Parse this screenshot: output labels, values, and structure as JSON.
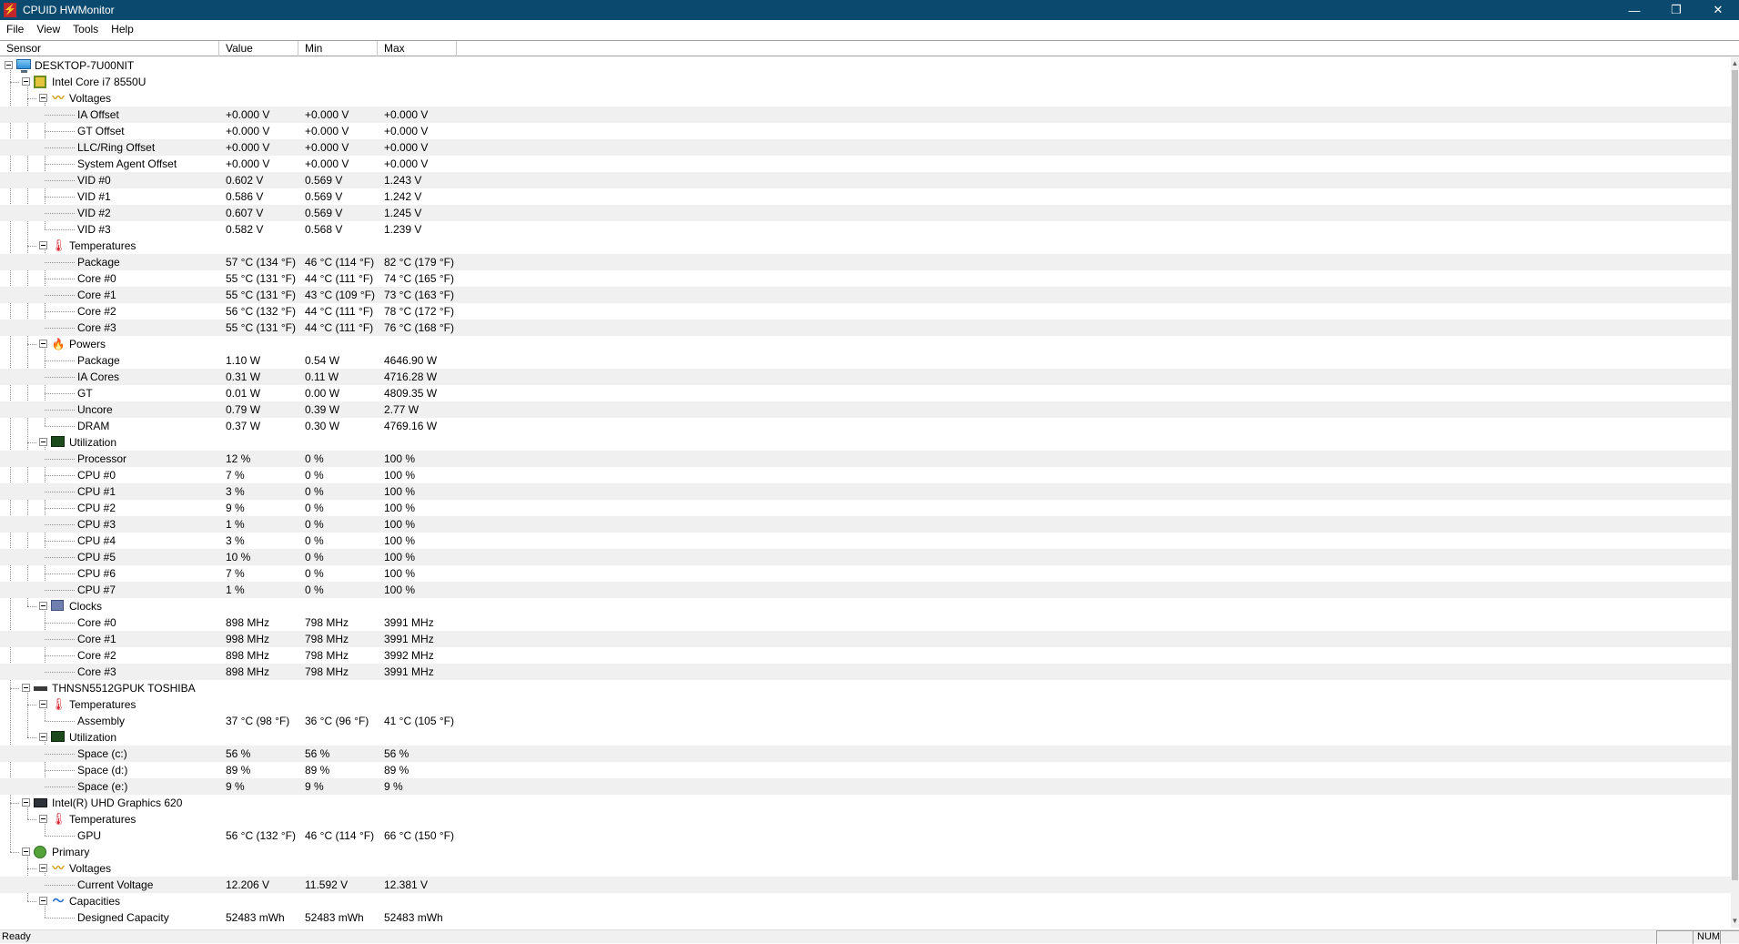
{
  "window": {
    "title": "CPUID HWMonitor",
    "icon": "hwmonitor-app-icon",
    "controls": {
      "minimize": "—",
      "restore": "❐",
      "close": "✕"
    }
  },
  "menu": [
    "File",
    "View",
    "Tools",
    "Help"
  ],
  "columns": {
    "sensor": "Sensor",
    "value": "Value",
    "min": "Min",
    "max": "Max"
  },
  "tree": [
    {
      "level": 0,
      "icon": "computer-icon",
      "label": "DESKTOP-7U00NIT"
    },
    {
      "level": 1,
      "icon": "cpu-icon",
      "label": "Intel Core i7 8550U"
    },
    {
      "level": 2,
      "icon": "voltage-icon",
      "label": "Voltages"
    },
    {
      "level": 3,
      "label": "IA Offset",
      "value": "+0.000 V",
      "min": "+0.000 V",
      "max": "+0.000 V"
    },
    {
      "level": 3,
      "label": "GT Offset",
      "value": "+0.000 V",
      "min": "+0.000 V",
      "max": "+0.000 V"
    },
    {
      "level": 3,
      "label": "LLC/Ring Offset",
      "value": "+0.000 V",
      "min": "+0.000 V",
      "max": "+0.000 V"
    },
    {
      "level": 3,
      "label": "System Agent Offset",
      "value": "+0.000 V",
      "min": "+0.000 V",
      "max": "+0.000 V"
    },
    {
      "level": 3,
      "label": "VID #0",
      "value": "0.602 V",
      "min": "0.569 V",
      "max": "1.243 V"
    },
    {
      "level": 3,
      "label": "VID #1",
      "value": "0.586 V",
      "min": "0.569 V",
      "max": "1.242 V"
    },
    {
      "level": 3,
      "label": "VID #2",
      "value": "0.607 V",
      "min": "0.569 V",
      "max": "1.245 V"
    },
    {
      "level": 3,
      "label": "VID #3",
      "value": "0.582 V",
      "min": "0.568 V",
      "max": "1.239 V"
    },
    {
      "level": 2,
      "icon": "thermometer-icon",
      "label": "Temperatures"
    },
    {
      "level": 3,
      "label": "Package",
      "value": "57 °C  (134 °F)",
      "min": "46 °C  (114 °F)",
      "max": "82 °C  (179 °F)"
    },
    {
      "level": 3,
      "label": "Core #0",
      "value": "55 °C  (131 °F)",
      "min": "44 °C  (111 °F)",
      "max": "74 °C  (165 °F)"
    },
    {
      "level": 3,
      "label": "Core #1",
      "value": "55 °C  (131 °F)",
      "min": "43 °C  (109 °F)",
      "max": "73 °C  (163 °F)"
    },
    {
      "level": 3,
      "label": "Core #2",
      "value": "56 °C  (132 °F)",
      "min": "44 °C  (111 °F)",
      "max": "78 °C  (172 °F)"
    },
    {
      "level": 3,
      "label": "Core #3",
      "value": "55 °C  (131 °F)",
      "min": "44 °C  (111 °F)",
      "max": "76 °C  (168 °F)"
    },
    {
      "level": 2,
      "icon": "power-icon",
      "label": "Powers"
    },
    {
      "level": 3,
      "label": "Package",
      "value": "1.10 W",
      "min": "0.54 W",
      "max": "4646.90 W"
    },
    {
      "level": 3,
      "label": "IA Cores",
      "value": "0.31 W",
      "min": "0.11 W",
      "max": "4716.28 W"
    },
    {
      "level": 3,
      "label": "GT",
      "value": "0.01 W",
      "min": "0.00 W",
      "max": "4809.35 W"
    },
    {
      "level": 3,
      "label": "Uncore",
      "value": "0.79 W",
      "min": "0.39 W",
      "max": "2.77 W"
    },
    {
      "level": 3,
      "label": "DRAM",
      "value": "0.37 W",
      "min": "0.30 W",
      "max": "4769.16 W"
    },
    {
      "level": 2,
      "icon": "utilization-icon",
      "label": "Utilization"
    },
    {
      "level": 3,
      "label": "Processor",
      "value": "12 %",
      "min": "0 %",
      "max": "100 %"
    },
    {
      "level": 3,
      "label": "CPU #0",
      "value": "7 %",
      "min": "0 %",
      "max": "100 %"
    },
    {
      "level": 3,
      "label": "CPU #1",
      "value": "3 %",
      "min": "0 %",
      "max": "100 %"
    },
    {
      "level": 3,
      "label": "CPU #2",
      "value": "9 %",
      "min": "0 %",
      "max": "100 %"
    },
    {
      "level": 3,
      "label": "CPU #3",
      "value": "1 %",
      "min": "0 %",
      "max": "100 %"
    },
    {
      "level": 3,
      "label": "CPU #4",
      "value": "3 %",
      "min": "0 %",
      "max": "100 %"
    },
    {
      "level": 3,
      "label": "CPU #5",
      "value": "10 %",
      "min": "0 %",
      "max": "100 %"
    },
    {
      "level": 3,
      "label": "CPU #6",
      "value": "7 %",
      "min": "0 %",
      "max": "100 %"
    },
    {
      "level": 3,
      "label": "CPU #7",
      "value": "1 %",
      "min": "0 %",
      "max": "100 %"
    },
    {
      "level": 2,
      "icon": "clock-icon",
      "label": "Clocks"
    },
    {
      "level": 3,
      "label": "Core #0",
      "value": "898 MHz",
      "min": "798 MHz",
      "max": "3991 MHz"
    },
    {
      "level": 3,
      "label": "Core #1",
      "value": "998 MHz",
      "min": "798 MHz",
      "max": "3991 MHz"
    },
    {
      "level": 3,
      "label": "Core #2",
      "value": "898 MHz",
      "min": "798 MHz",
      "max": "3992 MHz"
    },
    {
      "level": 3,
      "label": "Core #3",
      "value": "898 MHz",
      "min": "798 MHz",
      "max": "3991 MHz"
    },
    {
      "level": 1,
      "icon": "disk-icon",
      "label": "THNSN5512GPUK TOSHIBA"
    },
    {
      "level": 2,
      "icon": "thermometer-icon",
      "label": "Temperatures"
    },
    {
      "level": 3,
      "label": "Assembly",
      "value": "37 °C  (98 °F)",
      "min": "36 °C  (96 °F)",
      "max": "41 °C  (105 °F)"
    },
    {
      "level": 2,
      "icon": "utilization-icon",
      "label": "Utilization"
    },
    {
      "level": 3,
      "label": "Space (c:)",
      "value": "56 %",
      "min": "56 %",
      "max": "56 %"
    },
    {
      "level": 3,
      "label": "Space (d:)",
      "value": "89 %",
      "min": "89 %",
      "max": "89 %"
    },
    {
      "level": 3,
      "label": "Space (e:)",
      "value": "9 %",
      "min": "9 %",
      "max": "9 %"
    },
    {
      "level": 1,
      "icon": "gpu-icon",
      "label": "Intel(R) UHD Graphics 620"
    },
    {
      "level": 2,
      "icon": "thermometer-icon",
      "label": "Temperatures"
    },
    {
      "level": 3,
      "label": "GPU",
      "value": "56 °C  (132 °F)",
      "min": "46 °C  (114 °F)",
      "max": "66 °C  (150 °F)"
    },
    {
      "level": 1,
      "icon": "battery-icon",
      "label": "Primary"
    },
    {
      "level": 2,
      "icon": "voltage-icon",
      "label": "Voltages"
    },
    {
      "level": 3,
      "label": "Current Voltage",
      "value": "12.206 V",
      "min": "11.592 V",
      "max": "12.381 V"
    },
    {
      "level": 2,
      "icon": "capacity-icon",
      "label": "Capacities"
    },
    {
      "level": 3,
      "label": "Designed Capacity",
      "value": "52483 mWh",
      "min": "52483 mWh",
      "max": "52483 mWh"
    }
  ],
  "status": {
    "text": "Ready",
    "num": "NUM"
  }
}
